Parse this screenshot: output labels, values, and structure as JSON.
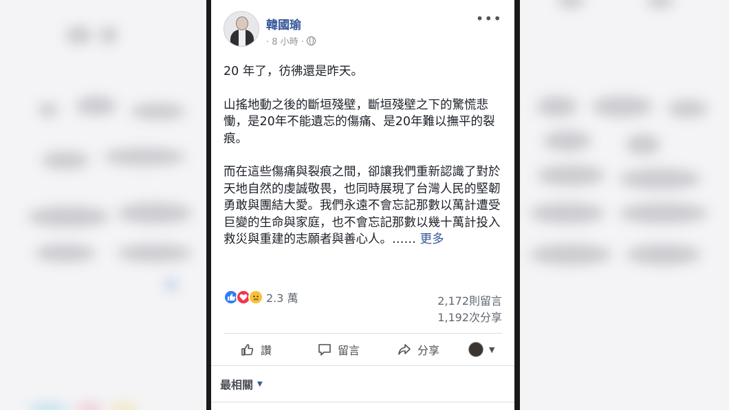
{
  "post": {
    "author": "韓國瑜",
    "timestamp": "· 8 小時 ·",
    "paragraphs": [
      "20 年了，彷彿還是昨天。",
      "山搖地動之後的斷垣殘壁，斷垣殘壁之下的驚慌悲慟，是20年不能遺忘的傷痛、是20年難以撫平的裂痕。",
      "而在這些傷痛與裂痕之間，卻讓我們重新認識了對於天地自然的虔誠敬畏，也同時展現了台灣人民的堅韌勇敢與團結大愛。我們永遠不會忘記那數以萬計遭受巨變的生命與家庭，也不會忘記那數以幾十萬計投入救災與重建的志願者與善心人。……"
    ],
    "see_more": "更多",
    "more_menu_icon": "•••"
  },
  "stats": {
    "reactions_count": "2.3 萬",
    "comments": "2,172則留言",
    "shares": "1,192次分享"
  },
  "actions": {
    "like": "讚",
    "comment": "留言",
    "share": "分享"
  },
  "comments_filter": {
    "label": "最相關"
  },
  "colors": {
    "link": "#365899",
    "like": "#2f7cf6",
    "love": "#f0364e",
    "sad": "#f7c23a"
  }
}
